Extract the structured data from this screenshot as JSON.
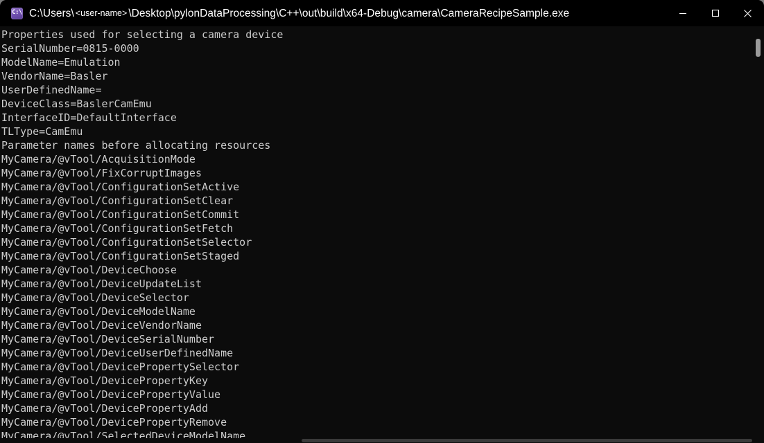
{
  "window": {
    "title_prefix": "C:\\Users\\",
    "title_user_token": "<user-name>",
    "title_suffix": "\\Desktop\\pylonDataProcessing\\C++\\out\\build\\x64-Debug\\camera\\CameraRecipeSample.exe",
    "icon_glyph": "C:\\",
    "icon_name": "console-app-icon",
    "colors": {
      "titlebar_background": "#000000",
      "console_background": "#0c0c0c",
      "console_text": "#cccccc",
      "icon_accent": "#6f4fae",
      "scrollbar_thumb": "#9b9b9b",
      "desktop_backdrop": "#7d7d7d"
    },
    "controls": {
      "minimize_label": "Minimize",
      "maximize_label": "Maximize",
      "close_label": "Close"
    }
  },
  "console": {
    "lines": [
      "Properties used for selecting a camera device",
      "SerialNumber=0815-0000",
      "ModelName=Emulation",
      "VendorName=Basler",
      "UserDefinedName=",
      "DeviceClass=BaslerCamEmu",
      "InterfaceID=DefaultInterface",
      "TLType=CamEmu",
      "Parameter names before allocating resources",
      "MyCamera/@vTool/AcquisitionMode",
      "MyCamera/@vTool/FixCorruptImages",
      "MyCamera/@vTool/ConfigurationSetActive",
      "MyCamera/@vTool/ConfigurationSetClear",
      "MyCamera/@vTool/ConfigurationSetCommit",
      "MyCamera/@vTool/ConfigurationSetFetch",
      "MyCamera/@vTool/ConfigurationSetSelector",
      "MyCamera/@vTool/ConfigurationSetStaged",
      "MyCamera/@vTool/DeviceChoose",
      "MyCamera/@vTool/DeviceUpdateList",
      "MyCamera/@vTool/DeviceSelector",
      "MyCamera/@vTool/DeviceModelName",
      "MyCamera/@vTool/DeviceVendorName",
      "MyCamera/@vTool/DeviceSerialNumber",
      "MyCamera/@vTool/DeviceUserDefinedName",
      "MyCamera/@vTool/DevicePropertySelector",
      "MyCamera/@vTool/DevicePropertyKey",
      "MyCamera/@vTool/DevicePropertyValue",
      "MyCamera/@vTool/DevicePropertyAdd",
      "MyCamera/@vTool/DevicePropertyRemove",
      "MyCamera/@vTool/SelectedDeviceModelName"
    ]
  },
  "scrollbars": {
    "vertical_name": "vertical-scrollbar",
    "horizontal_name": "horizontal-scrollbar"
  }
}
